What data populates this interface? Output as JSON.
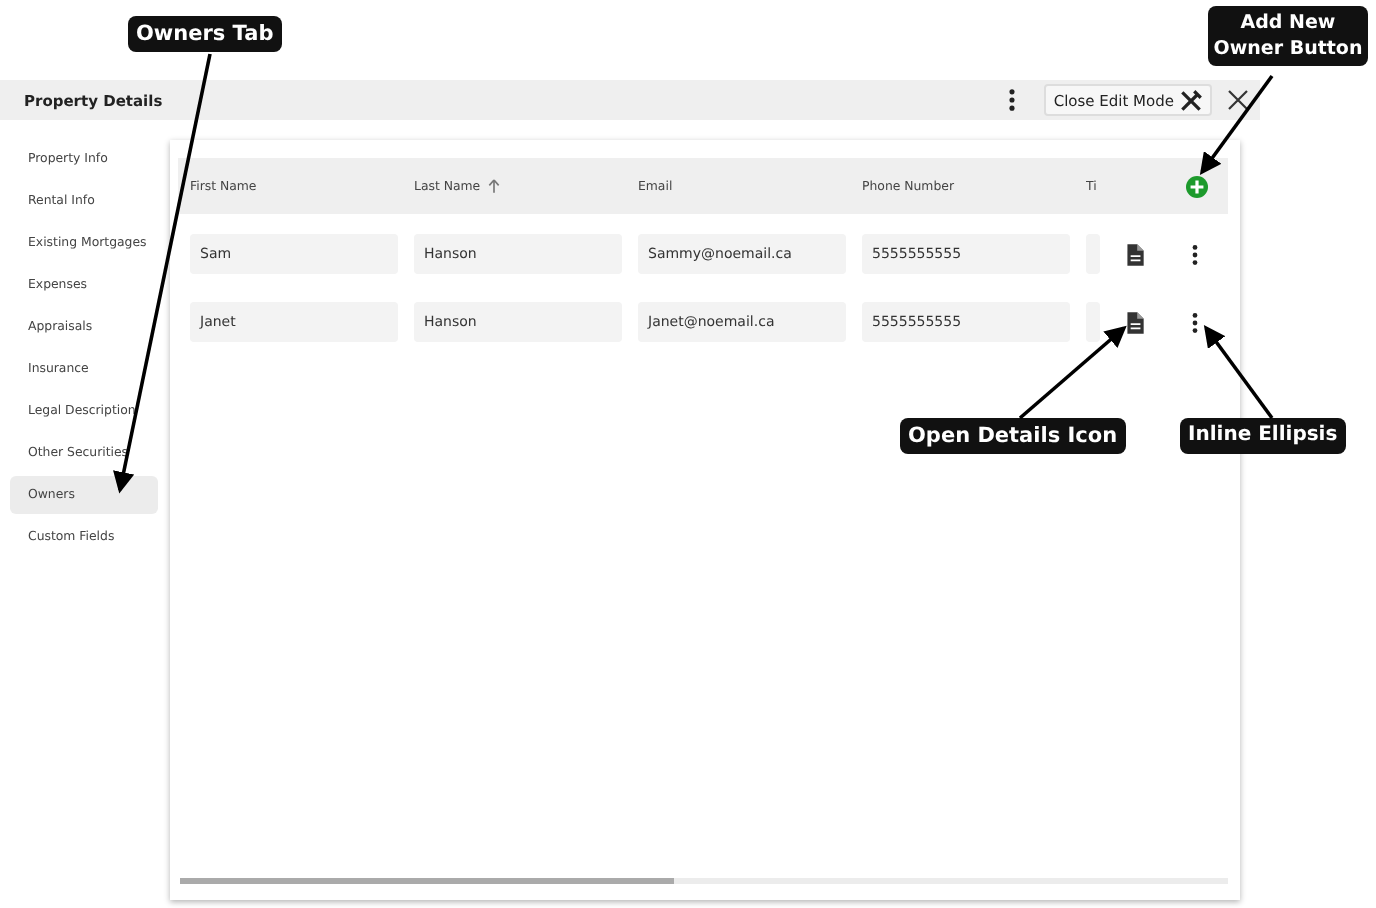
{
  "header": {
    "title": "Property Details",
    "close_edit_label": "Close Edit Mode"
  },
  "sidebar": {
    "items": [
      {
        "label": "Property Info",
        "selected": false
      },
      {
        "label": "Rental Info",
        "selected": false
      },
      {
        "label": "Existing Mortgages",
        "selected": false
      },
      {
        "label": "Expenses",
        "selected": false
      },
      {
        "label": "Appraisals",
        "selected": false
      },
      {
        "label": "Insurance",
        "selected": false
      },
      {
        "label": "Legal Description",
        "selected": false
      },
      {
        "label": "Other Securities",
        "selected": false
      },
      {
        "label": "Owners",
        "selected": true
      },
      {
        "label": "Custom Fields",
        "selected": false
      }
    ]
  },
  "table": {
    "columns": [
      {
        "label": "First Name",
        "sorted": false
      },
      {
        "label": "Last Name",
        "sorted": true
      },
      {
        "label": "Email",
        "sorted": false
      },
      {
        "label": "Phone Number",
        "sorted": false
      },
      {
        "label": "Ti",
        "sorted": false
      }
    ],
    "rows": [
      [
        "Sam",
        "Hanson",
        "Sammy@noemail.ca",
        "5555555555"
      ],
      [
        "Janet",
        "Hanson",
        "Janet@noemail.ca",
        "5555555555"
      ]
    ]
  },
  "callouts": [
    {
      "text": "Owners Tab"
    },
    {
      "text": "Add New Owner Button"
    },
    {
      "text": "Open Details Icon"
    },
    {
      "text": "Inline Ellipsis"
    }
  ]
}
